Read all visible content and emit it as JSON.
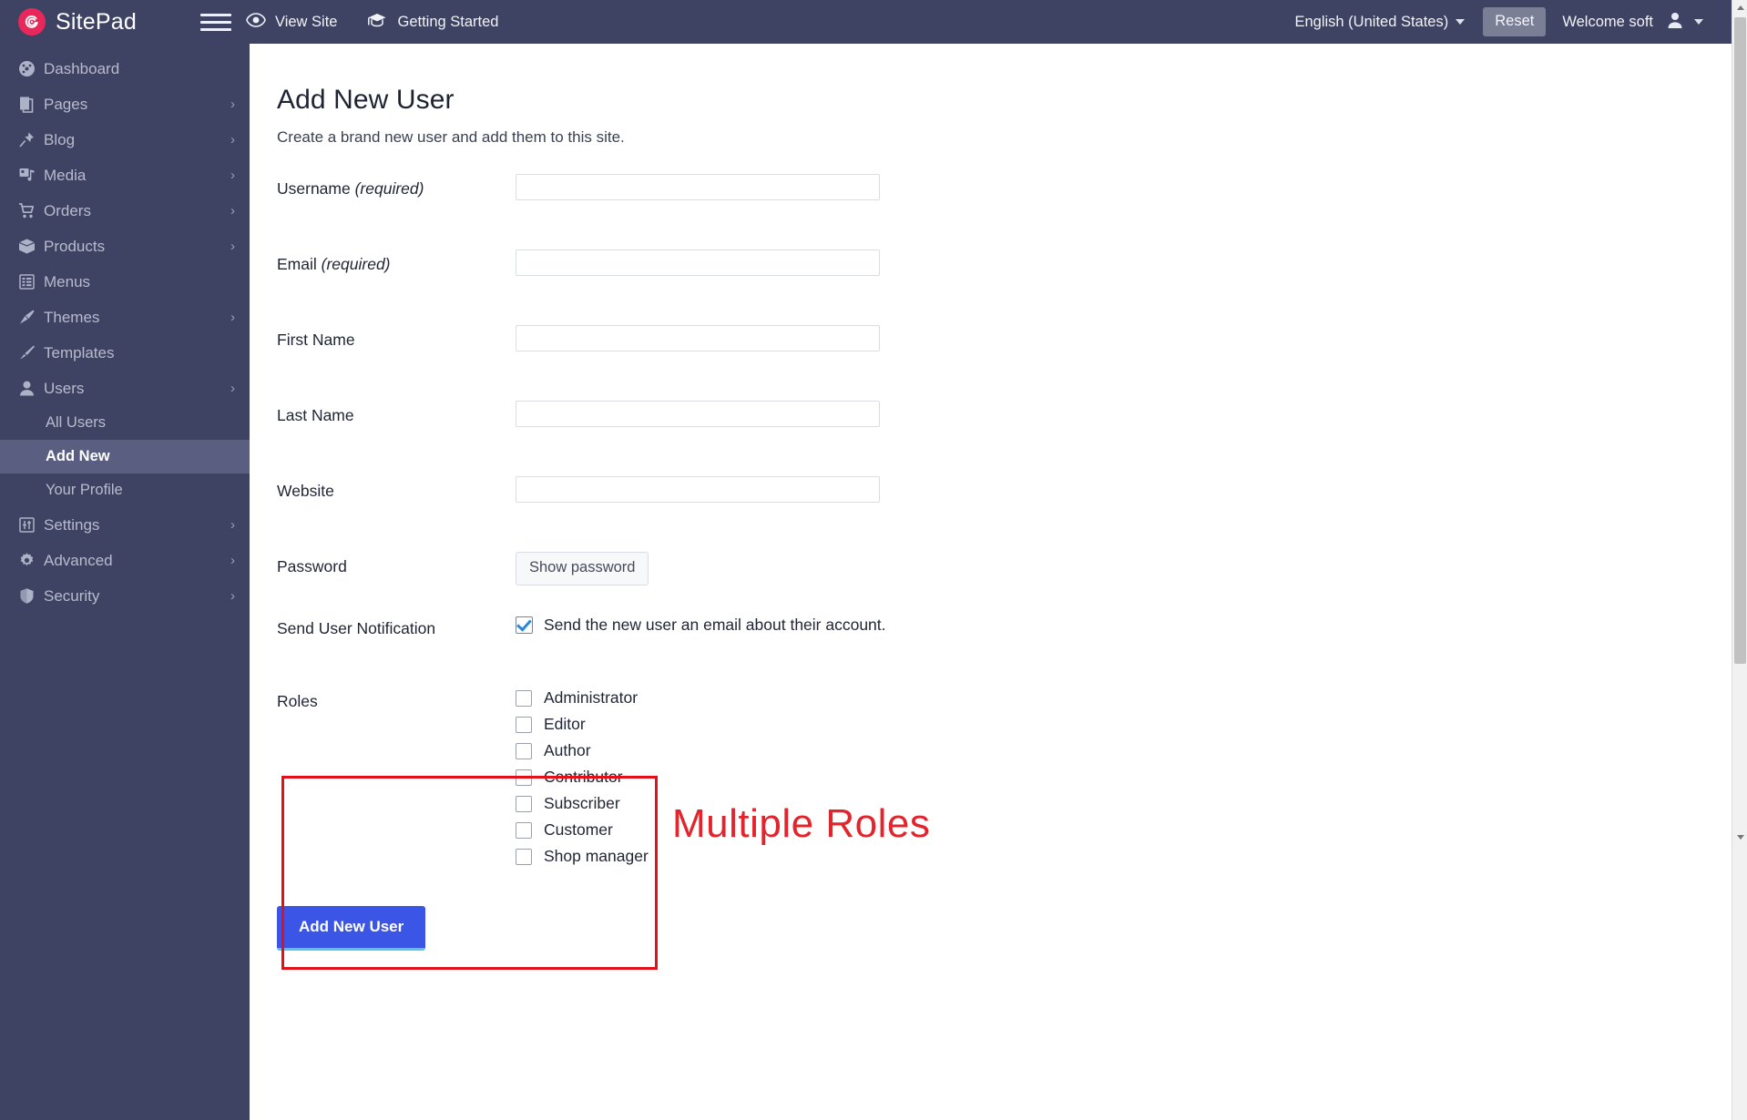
{
  "brand": {
    "name": "SitePad",
    "logo_icon": "sitepad-spiral-logo"
  },
  "topbar": {
    "menu_toggle_icon": "hamburger-menu-icon",
    "view_site": {
      "label": "View Site",
      "icon": "eye-icon"
    },
    "getting_started": {
      "label": "Getting Started",
      "icon": "graduation-cap-icon"
    },
    "language": {
      "label": "English (United States)",
      "icon": "chevron-down-icon"
    },
    "reset_label": "Reset",
    "welcome_label": "Welcome soft",
    "account_icon": "user-avatar-icon"
  },
  "sidebar": {
    "items": [
      {
        "label": "Dashboard",
        "icon": "gauge-icon",
        "has_chevron": false,
        "active": false
      },
      {
        "label": "Pages",
        "icon": "pages-icon",
        "has_chevron": true,
        "active": false
      },
      {
        "label": "Blog",
        "icon": "pin-icon",
        "has_chevron": true,
        "active": false
      },
      {
        "label": "Media",
        "icon": "media-icon",
        "has_chevron": true,
        "active": false
      },
      {
        "label": "Orders",
        "icon": "cart-icon",
        "has_chevron": true,
        "active": false
      },
      {
        "label": "Products",
        "icon": "box-icon",
        "has_chevron": true,
        "active": false
      },
      {
        "label": "Menus",
        "icon": "list-icon",
        "has_chevron": false,
        "active": false
      },
      {
        "label": "Themes",
        "icon": "brush-icon",
        "has_chevron": true,
        "active": false
      },
      {
        "label": "Templates",
        "icon": "paintbrush-icon",
        "has_chevron": false,
        "active": false
      },
      {
        "label": "Users",
        "icon": "user-icon",
        "has_chevron": true,
        "active": false
      }
    ],
    "user_subitems": [
      {
        "label": "All Users",
        "active": false
      },
      {
        "label": "Add New",
        "active": true
      },
      {
        "label": "Your Profile",
        "active": false
      }
    ],
    "bottom_items": [
      {
        "label": "Settings",
        "icon": "sliders-icon",
        "has_chevron": true
      },
      {
        "label": "Advanced",
        "icon": "gear-icon",
        "has_chevron": true
      },
      {
        "label": "Security",
        "icon": "shield-icon",
        "has_chevron": true
      }
    ]
  },
  "main": {
    "title": "Add New User",
    "subtitle": "Create a brand new user and add them to this site.",
    "fields": {
      "username": {
        "label": "Username",
        "required_text": "(required)",
        "value": "",
        "placeholder": ""
      },
      "email": {
        "label": "Email",
        "required_text": "(required)",
        "value": "",
        "placeholder": ""
      },
      "first_name": {
        "label": "First Name",
        "value": "",
        "placeholder": ""
      },
      "last_name": {
        "label": "Last Name",
        "value": "",
        "placeholder": ""
      },
      "website": {
        "label": "Website",
        "value": "",
        "placeholder": ""
      }
    },
    "password": {
      "label": "Password",
      "button_label": "Show password"
    },
    "notification": {
      "label": "Send User Notification",
      "checkbox_label": "Send the new user an email about their account.",
      "checked": true
    },
    "roles": {
      "label": "Roles",
      "options": [
        {
          "label": "Administrator",
          "checked": false
        },
        {
          "label": "Editor",
          "checked": false
        },
        {
          "label": "Author",
          "checked": false
        },
        {
          "label": "Contributor",
          "checked": false
        },
        {
          "label": "Subscriber",
          "checked": false
        },
        {
          "label": "Customer",
          "checked": false
        },
        {
          "label": "Shop manager",
          "checked": false
        }
      ]
    },
    "annotation": {
      "text": "Multiple Roles",
      "color": "#e3242c"
    },
    "submit_label": "Add New User"
  },
  "colors": {
    "sidebar_bg": "#3f4363",
    "brand_pink": "#e8275a",
    "primary_button": "#3b55e6",
    "highlight_red": "#e3101a",
    "active_item": "#5a5e80"
  }
}
